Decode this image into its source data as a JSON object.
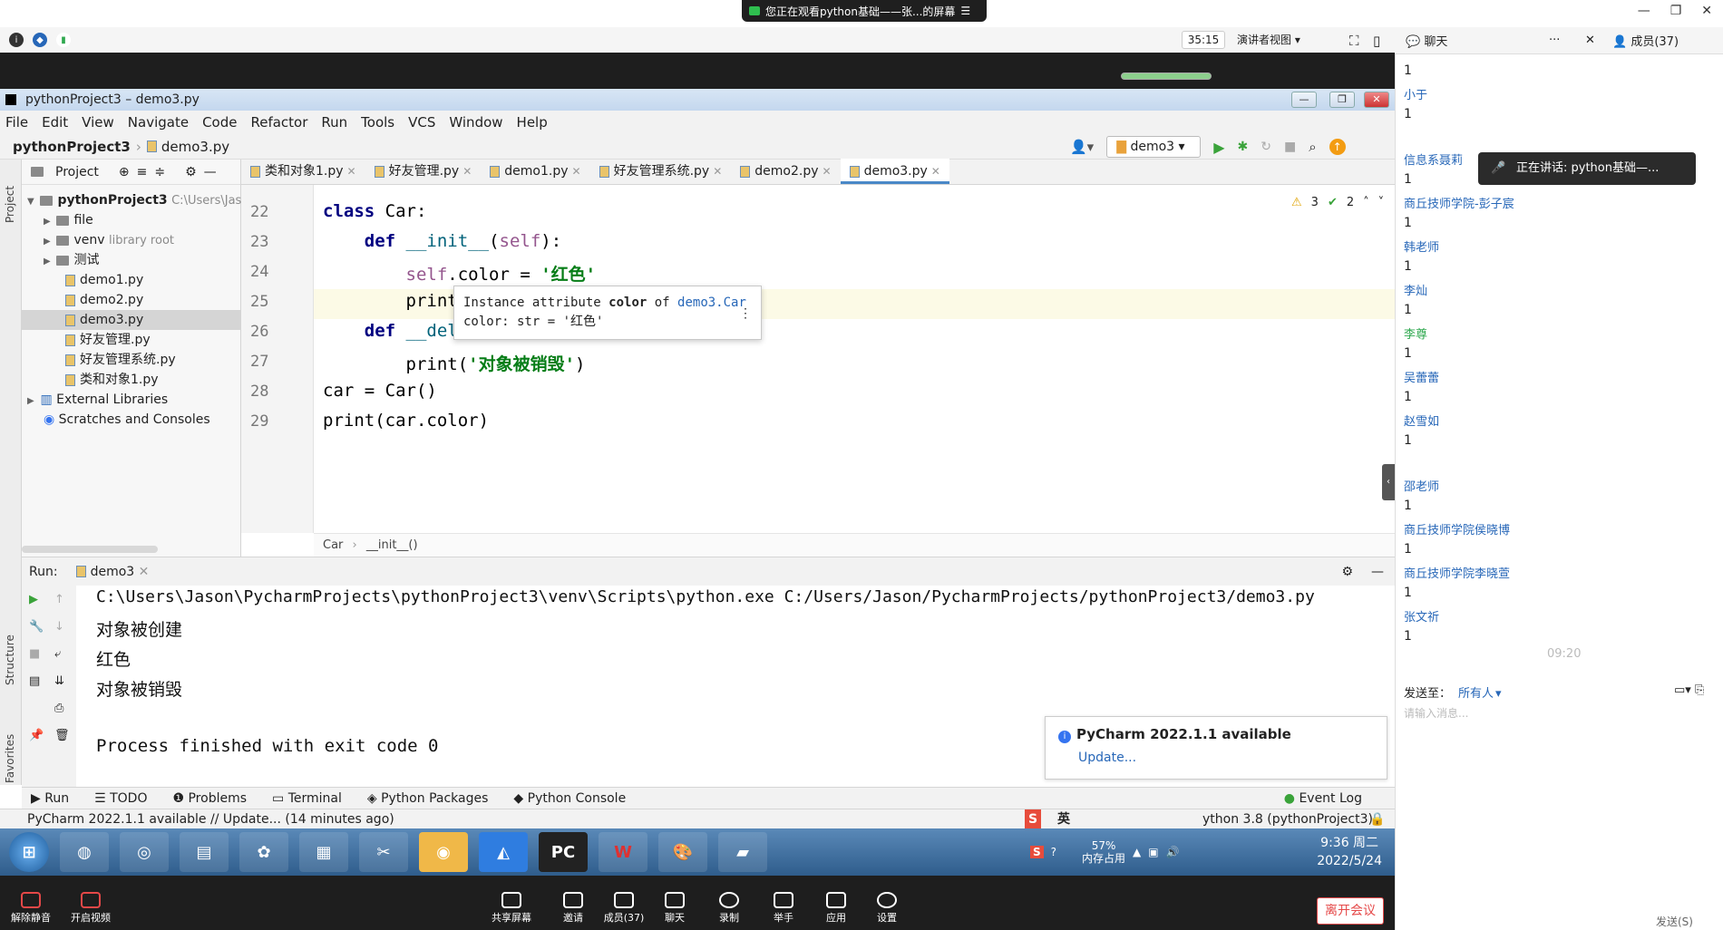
{
  "meeting": {
    "banner": "您正在观看python基础——张...的屏幕",
    "timer": "35:15",
    "view_mode": "演讲者视图",
    "chat_tab": "聊天",
    "members_tab": "成员(37)",
    "speaking": "正在讲话: python基础—...",
    "leave": "离开会议",
    "bottom_buttons": [
      "解除静音",
      "开启视频",
      "共享屏幕",
      "邀请",
      "成员(37)",
      "聊天",
      "录制",
      "举手",
      "应用",
      "设置"
    ],
    "send_to_label": "发送至：",
    "send_to_value": "所有人",
    "input_placeholder": "请输入消息...",
    "send_button": "发送(S)",
    "chat_time": "09:20",
    "chat_messages": [
      {
        "name": "",
        "text": "1"
      },
      {
        "name": "小于",
        "text": "1"
      },
      {
        "name": "信息系聂莉",
        "text": "1"
      },
      {
        "name": "商丘技师学院-彭子宸",
        "text": "1"
      },
      {
        "name": "韩老师",
        "text": "1"
      },
      {
        "name": "李灿",
        "text": "1"
      },
      {
        "name": "李尊",
        "text": "1"
      },
      {
        "name": "吴蕾蕾",
        "text": "1"
      },
      {
        "name": "赵雪如",
        "text": "1"
      },
      {
        "name": "邵老师",
        "text": "1"
      },
      {
        "name": "商丘技师学院侯晓博",
        "text": "1"
      },
      {
        "name": "商丘技师学院李晓萱",
        "text": "1"
      },
      {
        "name": "张文祈",
        "text": "1"
      }
    ]
  },
  "ide": {
    "window_title": "pythonProject3 – demo3.py",
    "menu": [
      "File",
      "Edit",
      "View",
      "Navigate",
      "Code",
      "Refactor",
      "Run",
      "Tools",
      "VCS",
      "Window",
      "Help"
    ],
    "breadcrumb_project": "pythonProject3",
    "breadcrumb_file": "demo3.py",
    "run_config": "demo3",
    "project_label": "Project",
    "tree": [
      {
        "label": "pythonProject3",
        "extra": "C:\\Users\\Jas",
        "type": "root"
      },
      {
        "label": "file",
        "extra": "",
        "type": "folder"
      },
      {
        "label": "venv",
        "extra": "library root",
        "type": "folder"
      },
      {
        "label": "测试",
        "extra": "",
        "type": "folder"
      },
      {
        "label": "demo1.py",
        "extra": "",
        "type": "py"
      },
      {
        "label": "demo2.py",
        "extra": "",
        "type": "py"
      },
      {
        "label": "demo3.py",
        "extra": "",
        "type": "py"
      },
      {
        "label": "好友管理.py",
        "extra": "",
        "type": "py"
      },
      {
        "label": "好友管理系统.py",
        "extra": "",
        "type": "py"
      },
      {
        "label": "类和对象1.py",
        "extra": "",
        "type": "py"
      },
      {
        "label": "External Libraries",
        "extra": "",
        "type": "lib"
      },
      {
        "label": "Scratches and Consoles",
        "extra": "",
        "type": "scratch"
      }
    ],
    "tabs": [
      "类和对象1.py",
      "好友管理.py",
      "demo1.py",
      "好友管理系统.py",
      "demo2.py",
      "demo3.py"
    ],
    "active_tab": "demo3.py",
    "inspections": {
      "warnings": "3",
      "ok": "2"
    },
    "line_numbers": [
      "22",
      "23",
      "24",
      "25",
      "26",
      "27",
      "28",
      "29"
    ],
    "tooltip_line1_pre": "Instance attribute ",
    "tooltip_attr": "color",
    "tooltip_of": " of ",
    "tooltip_class": "demo3.Car",
    "tooltip_line2": "color: str = '红色'",
    "code_breadcrumb": [
      "Car",
      "__init__()"
    ],
    "run_label": "Run:",
    "run_tab": "demo3",
    "console": [
      "C:\\Users\\Jason\\PycharmProjects\\pythonProject3\\venv\\Scripts\\python.exe C:/Users/Jason/PycharmProjects/pythonProject3/demo3.py",
      "对象被创建",
      "红色",
      "对象被销毁",
      "",
      "Process finished with exit code 0"
    ],
    "notification_title": "PyCharm 2022.1.1 available",
    "notification_link": "Update...",
    "bottom_tabs": [
      "Run",
      "TODO",
      "Problems",
      "Terminal",
      "Python Packages",
      "Python Console"
    ],
    "event_log": "Event Log",
    "status": "PyCharm 2022.1.1 available // Update... (14 minutes ago)",
    "interpreter": "ython 3.8 (pythonProject3)",
    "left_strip": [
      "Project",
      "Structure",
      "Favorites"
    ]
  },
  "taskbar": {
    "memory": "57%",
    "memory_label": "内存占用",
    "time": "9:36 周二",
    "date": "2022/5/24",
    "ime": "英"
  }
}
